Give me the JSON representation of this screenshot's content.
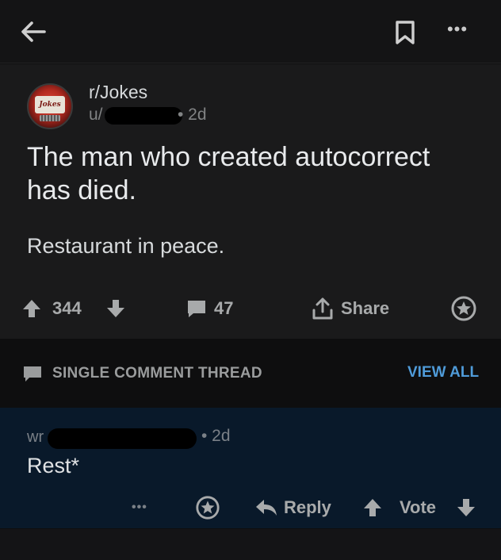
{
  "topbar": {
    "back_icon": "arrow-left-icon",
    "bookmark_icon": "bookmark-icon",
    "more_label": "•••"
  },
  "post": {
    "subreddit": "r/Jokes",
    "user_prefix": "u/",
    "age": "• 2d",
    "avatar_text": "Jokes",
    "title": "The man who created autocorrect has died.",
    "body": "Restaurant in peace.",
    "upvotes": "344",
    "comments": "47",
    "share_label": "Share",
    "award_icon": "award-icon"
  },
  "thread": {
    "label": "SINGLE COMMENT THREAD",
    "view_all": "VIEW ALL"
  },
  "comment": {
    "author_prefix": "wr",
    "age": "• 2d",
    "body": "Rest*",
    "more_label": "•••",
    "reply_label": "Reply",
    "vote_label": "Vote"
  },
  "colors": {
    "background": "#0e0e0f",
    "post_bg": "#1a1a1b",
    "comment_bg": "#09192a",
    "link_blue": "#4f9bd9",
    "muted_text": "#818384"
  }
}
